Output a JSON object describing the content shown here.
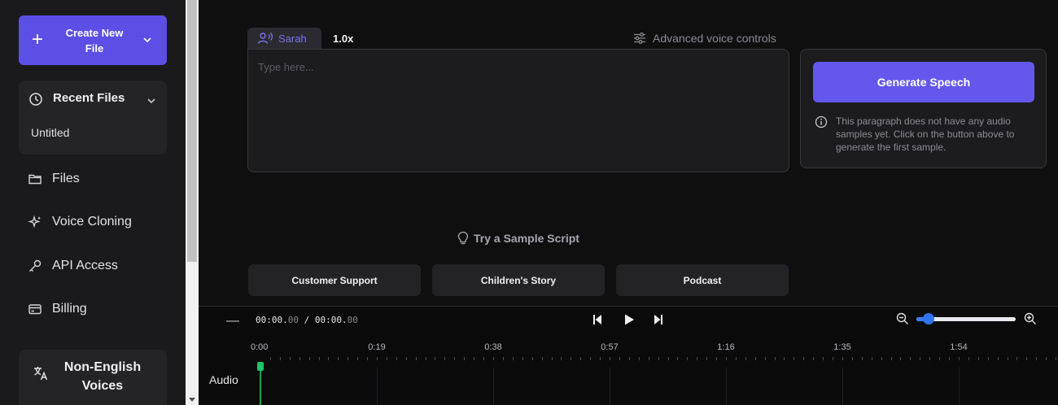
{
  "sidebar": {
    "create_button": "Create New File",
    "recent_files": {
      "title": "Recent Files",
      "items": [
        "Untitled"
      ]
    },
    "nav": [
      {
        "label": "Files",
        "icon": "folder-icon"
      },
      {
        "label": "Voice Cloning",
        "icon": "sparkles-icon"
      },
      {
        "label": "API Access",
        "icon": "key-icon"
      },
      {
        "label": "Billing",
        "icon": "credit-card-icon"
      }
    ],
    "non_english": "Non-English Voices"
  },
  "editor": {
    "voice_name": "Sarah",
    "speed": "1.0x",
    "advanced_controls": "Advanced voice controls",
    "placeholder": "Type here..."
  },
  "generate": {
    "button": "Generate Speech",
    "info": "This paragraph does not have any audio samples yet. Click on the button above to generate the first sample."
  },
  "samples": {
    "title": "Try a Sample Script",
    "items": [
      "Customer Support",
      "Children's Story",
      "Podcast"
    ]
  },
  "timeline": {
    "collapse": "—",
    "current_main": "00:00.",
    "current_ms": "00",
    "separator": " / ",
    "total_main": "00:00.",
    "total_ms": "00",
    "zoom_level": 0.12,
    "ruler": [
      "0:00",
      "0:19",
      "0:38",
      "0:57",
      "1:16",
      "1:35",
      "1:54"
    ],
    "track_label": "Audio"
  },
  "colors": {
    "accent": "#5b4fe6",
    "background": "#0f0f10",
    "sidebar": "#1a1a1c",
    "playhead": "#21c465",
    "zoom_slider": "#2f74ee"
  }
}
